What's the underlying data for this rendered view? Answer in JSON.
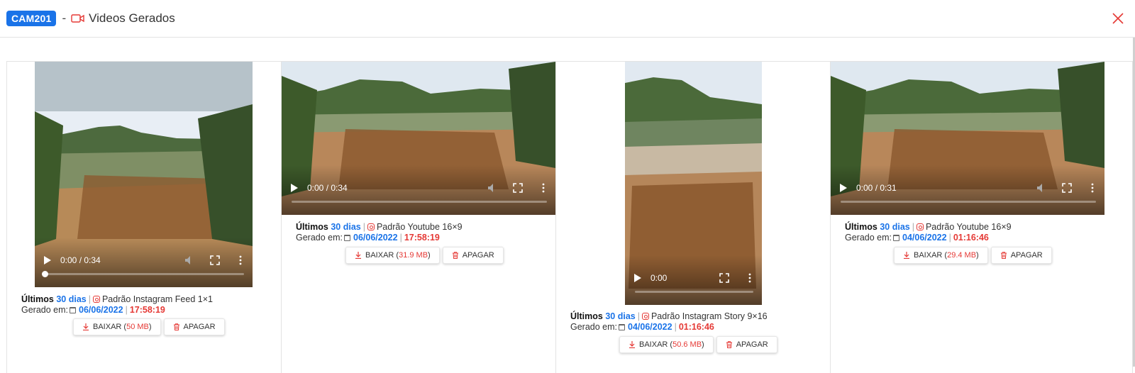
{
  "header": {
    "camera_badge": "CAM201",
    "separator": "-",
    "title": "Videos Gerados"
  },
  "videos": [
    {
      "time": "0:00 / 0:34",
      "period_prefix": "Últimos",
      "period_value": "30 dias",
      "format": "Padrão Instagram Feed 1×1",
      "generated_label": "Gerado em:",
      "date": "06/06/2022",
      "clock": "17:58:19",
      "download_label": "BAIXAR (",
      "size": "50 MB",
      "download_close": ")",
      "delete_label": "APAGAR",
      "progress": 0
    },
    {
      "time": "0:00 / 0:34",
      "period_prefix": "Últimos",
      "period_value": "30 dias",
      "format": "Padrão Youtube 16×9",
      "generated_label": "Gerado em:",
      "date": "06/06/2022",
      "clock": "17:58:19",
      "download_label": "BAIXAR (",
      "size": "31.9 MB",
      "download_close": ")",
      "delete_label": "APAGAR",
      "progress": 0
    },
    {
      "time": "0:00",
      "period_prefix": "Últimos",
      "period_value": "30 dias",
      "format": "Padrão Instagram Story 9×16",
      "generated_label": "Gerado em:",
      "date": "04/06/2022",
      "clock": "01:16:46",
      "download_label": "BAIXAR (",
      "size": "50.6 MB",
      "download_close": ")",
      "delete_label": "APAGAR",
      "progress": 0
    },
    {
      "time": "0:00 / 0:31",
      "period_prefix": "Últimos",
      "period_value": "30 dias",
      "format": "Padrão Youtube 16×9",
      "generated_label": "Gerado em:",
      "date": "04/06/2022",
      "clock": "01:16:46",
      "download_label": "BAIXAR (",
      "size": "29.4 MB",
      "download_close": ")",
      "delete_label": "APAGAR",
      "progress": 0
    }
  ],
  "colors": {
    "accent_blue": "#1a73e8",
    "accent_red": "#e53935"
  }
}
